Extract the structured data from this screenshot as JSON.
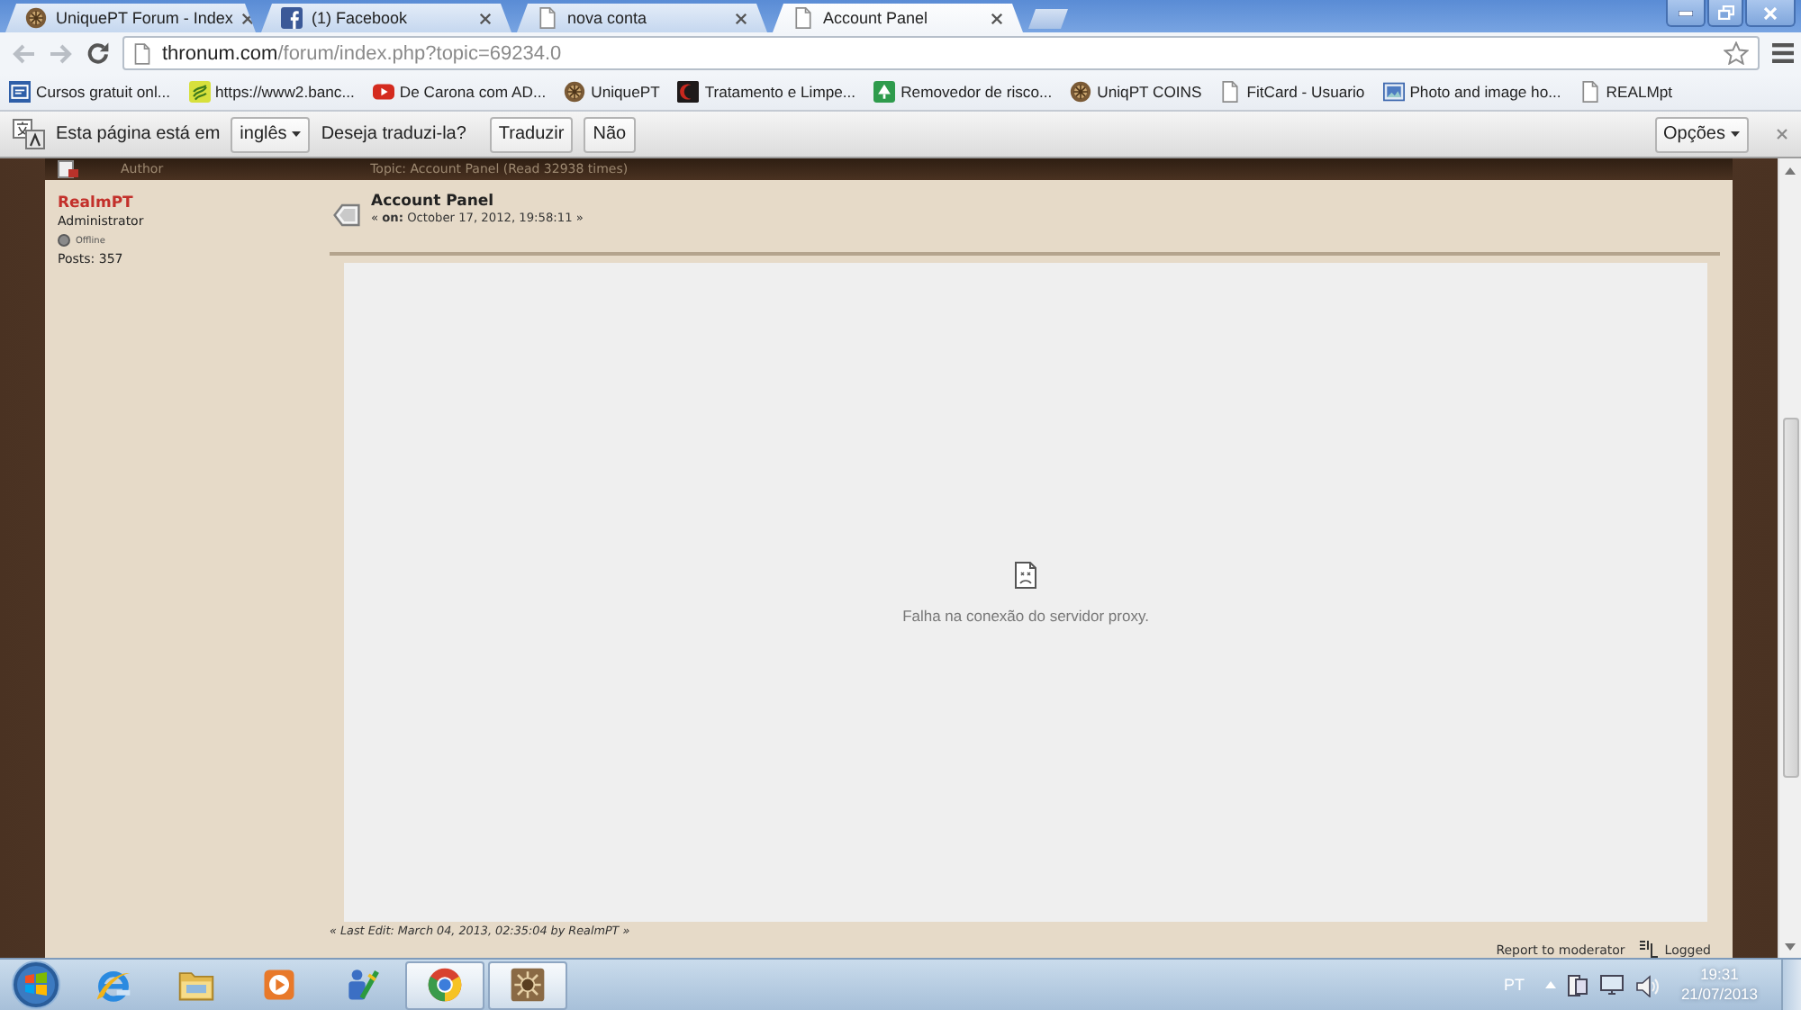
{
  "browser": {
    "tabs": [
      {
        "title": "UniquePT Forum - Index",
        "kind": "emblem",
        "selected": false
      },
      {
        "title": "(1) Facebook",
        "kind": "f-logo",
        "selected": false
      },
      {
        "title": "nova conta",
        "kind": "page",
        "selected": false
      },
      {
        "title": "Account Panel",
        "kind": "page",
        "selected": true
      }
    ],
    "back": {
      "disabled": true
    },
    "forward": {
      "disabled": true
    },
    "address": {
      "host": "thronum.com",
      "path": "/forum/index.php?topic=69234.0"
    },
    "bookmarks": [
      {
        "label": "Cursos gratuit onl...",
        "kind": "ssi"
      },
      {
        "label": "https://www2.banc...",
        "kind": "coin"
      },
      {
        "label": "De Carona com AD...",
        "kind": "video"
      },
      {
        "label": "UniquePT",
        "kind": "emblem"
      },
      {
        "label": "Tratamento e Limpe...",
        "kind": "moon"
      },
      {
        "label": "Removedor de risco...",
        "kind": "tree"
      },
      {
        "label": "UniqPT COINS",
        "kind": "emblem"
      },
      {
        "label": "FitCard - Usuario",
        "kind": "page"
      },
      {
        "label": "Photo and image ho...",
        "kind": "photo"
      },
      {
        "label": "REALMpt",
        "kind": "page"
      }
    ]
  },
  "translate_bar": {
    "message": "Esta página está em",
    "language": "inglês",
    "question": "Deseja traduzi-la?",
    "buttons": [
      "Traduzir",
      "Não"
    ],
    "options": "Opções"
  },
  "forum": {
    "header": {
      "author": "Author",
      "topic": "Topic: Account Panel (Read 32938 times)"
    },
    "poster": {
      "name": "RealmPT",
      "role": "Administrator",
      "status": "Offline",
      "online": false,
      "posts": "Posts: 357"
    },
    "post": {
      "title": "Account Panel",
      "date": "« **on:** October 17, 2012, 19:58:11 »",
      "error": "Falha na conexão do servidor proxy.",
      "last_edit": "« Last Edit: March 04, 2013, 02:35:04 by RealmPT »",
      "report": "Report to moderator",
      "logged": "Logged"
    }
  },
  "taskbar": {
    "apps": [
      {
        "kind": "ie",
        "running": false
      },
      {
        "kind": "folder",
        "running": false
      },
      {
        "kind": "media",
        "running": false
      },
      {
        "kind": "tool",
        "running": false
      },
      {
        "kind": "chrome",
        "running": true
      },
      {
        "kind": "emblem",
        "running": true
      }
    ],
    "language": "PT",
    "time": "19:31",
    "date": "21/07/2013"
  }
}
